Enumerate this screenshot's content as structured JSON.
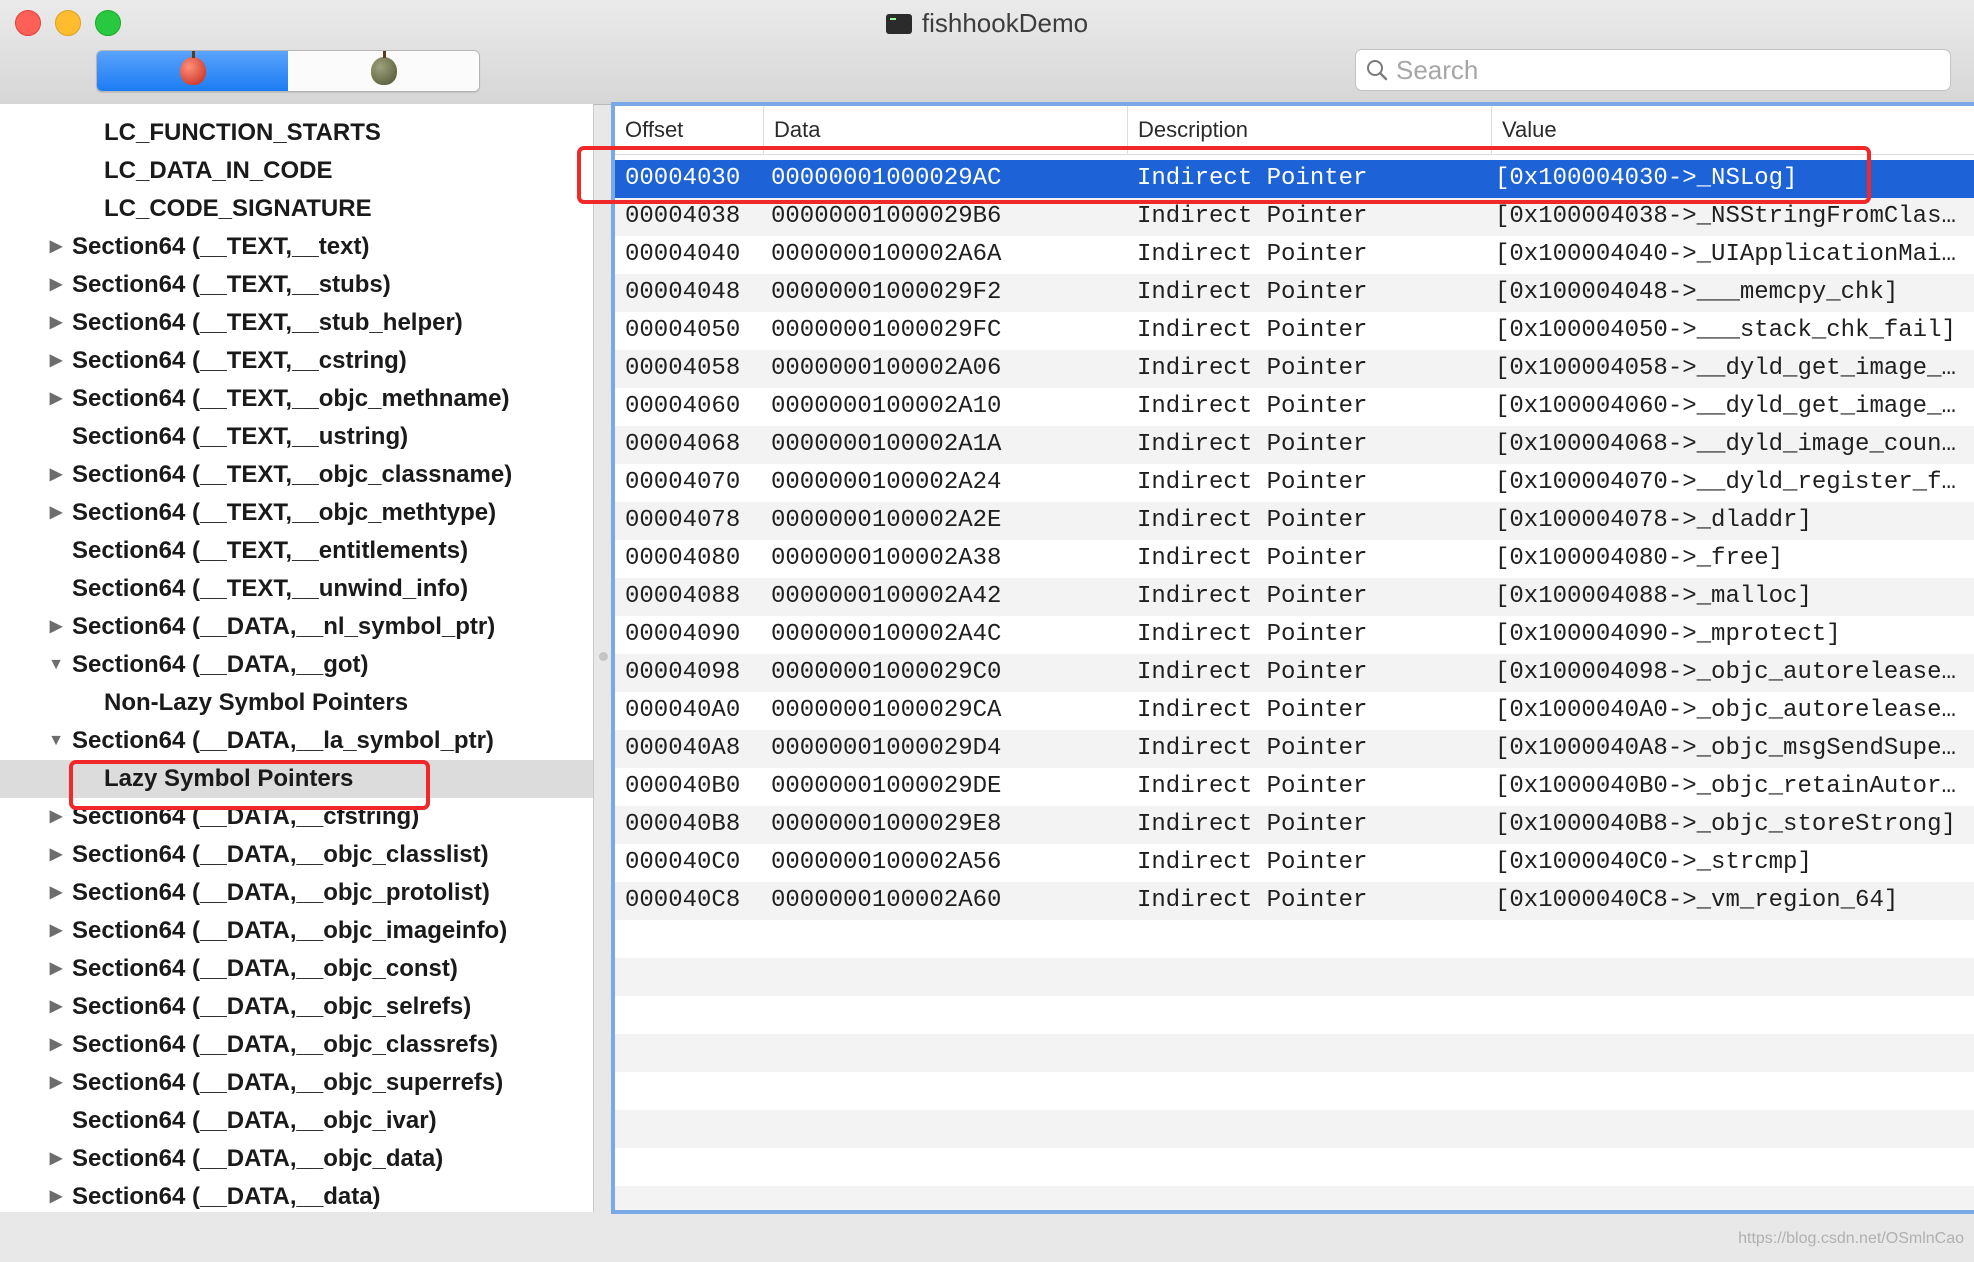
{
  "window": {
    "title": "fishhookDemo"
  },
  "toolbar": {
    "search_placeholder": "Search"
  },
  "sidebar": {
    "items": [
      {
        "label": "LC_FUNCTION_STARTS",
        "level": 2,
        "arrow": "none"
      },
      {
        "label": "LC_DATA_IN_CODE",
        "level": 2,
        "arrow": "none"
      },
      {
        "label": "LC_CODE_SIGNATURE",
        "level": 2,
        "arrow": "none"
      },
      {
        "label": "Section64 (__TEXT,__text)",
        "level": 1,
        "arrow": "right"
      },
      {
        "label": "Section64 (__TEXT,__stubs)",
        "level": 1,
        "arrow": "right"
      },
      {
        "label": "Section64 (__TEXT,__stub_helper)",
        "level": 1,
        "arrow": "right"
      },
      {
        "label": "Section64 (__TEXT,__cstring)",
        "level": 1,
        "arrow": "right"
      },
      {
        "label": "Section64 (__TEXT,__objc_methname)",
        "level": 1,
        "arrow": "right"
      },
      {
        "label": "Section64 (__TEXT,__ustring)",
        "level": 1,
        "arrow": "none"
      },
      {
        "label": "Section64 (__TEXT,__objc_classname)",
        "level": 1,
        "arrow": "right"
      },
      {
        "label": "Section64 (__TEXT,__objc_methtype)",
        "level": 1,
        "arrow": "right"
      },
      {
        "label": "Section64 (__TEXT,__entitlements)",
        "level": 1,
        "arrow": "none"
      },
      {
        "label": "Section64 (__TEXT,__unwind_info)",
        "level": 1,
        "arrow": "none"
      },
      {
        "label": "Section64 (__DATA,__nl_symbol_ptr)",
        "level": 1,
        "arrow": "right"
      },
      {
        "label": "Section64 (__DATA,__got)",
        "level": 1,
        "arrow": "down"
      },
      {
        "label": "Non-Lazy Symbol Pointers",
        "level": 2,
        "arrow": "none"
      },
      {
        "label": "Section64 (__DATA,__la_symbol_ptr)",
        "level": 1,
        "arrow": "down"
      },
      {
        "label": "Lazy Symbol Pointers",
        "level": 2,
        "arrow": "none",
        "selected": true
      },
      {
        "label": "Section64 (__DATA,__cfstring)",
        "level": 1,
        "arrow": "right"
      },
      {
        "label": "Section64 (__DATA,__objc_classlist)",
        "level": 1,
        "arrow": "right"
      },
      {
        "label": "Section64 (__DATA,__objc_protolist)",
        "level": 1,
        "arrow": "right"
      },
      {
        "label": "Section64 (__DATA,__objc_imageinfo)",
        "level": 1,
        "arrow": "right"
      },
      {
        "label": "Section64 (__DATA,__objc_const)",
        "level": 1,
        "arrow": "right"
      },
      {
        "label": "Section64 (__DATA,__objc_selrefs)",
        "level": 1,
        "arrow": "right"
      },
      {
        "label": "Section64 (__DATA,__objc_classrefs)",
        "level": 1,
        "arrow": "right"
      },
      {
        "label": "Section64 (__DATA,__objc_superrefs)",
        "level": 1,
        "arrow": "right"
      },
      {
        "label": "Section64 (__DATA,__objc_ivar)",
        "level": 1,
        "arrow": "none"
      },
      {
        "label": "Section64 (__DATA,__objc_data)",
        "level": 1,
        "arrow": "right"
      },
      {
        "label": "Section64 (__DATA,__data)",
        "level": 1,
        "arrow": "right"
      }
    ]
  },
  "table": {
    "columns": [
      "Offset",
      "Data",
      "Description",
      "Value"
    ],
    "rows": [
      {
        "offset": "00004030",
        "data": "00000001000029AC",
        "description": "Indirect Pointer",
        "value": "[0x100004030->_NSLog]",
        "selected": true
      },
      {
        "offset": "00004038",
        "data": "00000001000029B6",
        "description": "Indirect Pointer",
        "value": "[0x100004038->_NSStringFromClas…"
      },
      {
        "offset": "00004040",
        "data": "0000000100002A6A",
        "description": "Indirect Pointer",
        "value": "[0x100004040->_UIApplicationMai…"
      },
      {
        "offset": "00004048",
        "data": "00000001000029F2",
        "description": "Indirect Pointer",
        "value": "[0x100004048->___memcpy_chk]"
      },
      {
        "offset": "00004050",
        "data": "00000001000029FC",
        "description": "Indirect Pointer",
        "value": "[0x100004050->___stack_chk_fail]"
      },
      {
        "offset": "00004058",
        "data": "0000000100002A06",
        "description": "Indirect Pointer",
        "value": "[0x100004058->__dyld_get_image_…"
      },
      {
        "offset": "00004060",
        "data": "0000000100002A10",
        "description": "Indirect Pointer",
        "value": "[0x100004060->__dyld_get_image_…"
      },
      {
        "offset": "00004068",
        "data": "0000000100002A1A",
        "description": "Indirect Pointer",
        "value": "[0x100004068->__dyld_image_coun…"
      },
      {
        "offset": "00004070",
        "data": "0000000100002A24",
        "description": "Indirect Pointer",
        "value": "[0x100004070->__dyld_register_f…"
      },
      {
        "offset": "00004078",
        "data": "0000000100002A2E",
        "description": "Indirect Pointer",
        "value": "[0x100004078->_dladdr]"
      },
      {
        "offset": "00004080",
        "data": "0000000100002A38",
        "description": "Indirect Pointer",
        "value": "[0x100004080->_free]"
      },
      {
        "offset": "00004088",
        "data": "0000000100002A42",
        "description": "Indirect Pointer",
        "value": "[0x100004088->_malloc]"
      },
      {
        "offset": "00004090",
        "data": "0000000100002A4C",
        "description": "Indirect Pointer",
        "value": "[0x100004090->_mprotect]"
      },
      {
        "offset": "00004098",
        "data": "00000001000029C0",
        "description": "Indirect Pointer",
        "value": "[0x100004098->_objc_autorelease…"
      },
      {
        "offset": "000040A0",
        "data": "00000001000029CA",
        "description": "Indirect Pointer",
        "value": "[0x1000040A0->_objc_autorelease…"
      },
      {
        "offset": "000040A8",
        "data": "00000001000029D4",
        "description": "Indirect Pointer",
        "value": "[0x1000040A8->_objc_msgSendSupe…"
      },
      {
        "offset": "000040B0",
        "data": "00000001000029DE",
        "description": "Indirect Pointer",
        "value": "[0x1000040B0->_objc_retainAutor…"
      },
      {
        "offset": "000040B8",
        "data": "00000001000029E8",
        "description": "Indirect Pointer",
        "value": "[0x1000040B8->_objc_storeStrong]"
      },
      {
        "offset": "000040C0",
        "data": "0000000100002A56",
        "description": "Indirect Pointer",
        "value": "[0x1000040C0->_strcmp]"
      },
      {
        "offset": "000040C8",
        "data": "0000000100002A60",
        "description": "Indirect Pointer",
        "value": "[0x1000040C8->_vm_region_64]"
      }
    ]
  },
  "watermark": "https://blog.csdn.net/OSmlnCao",
  "colors": {
    "selection_blue": "#1d62d6",
    "highlight_red": "#f0282a",
    "focus_ring": "#7aa9e8"
  }
}
